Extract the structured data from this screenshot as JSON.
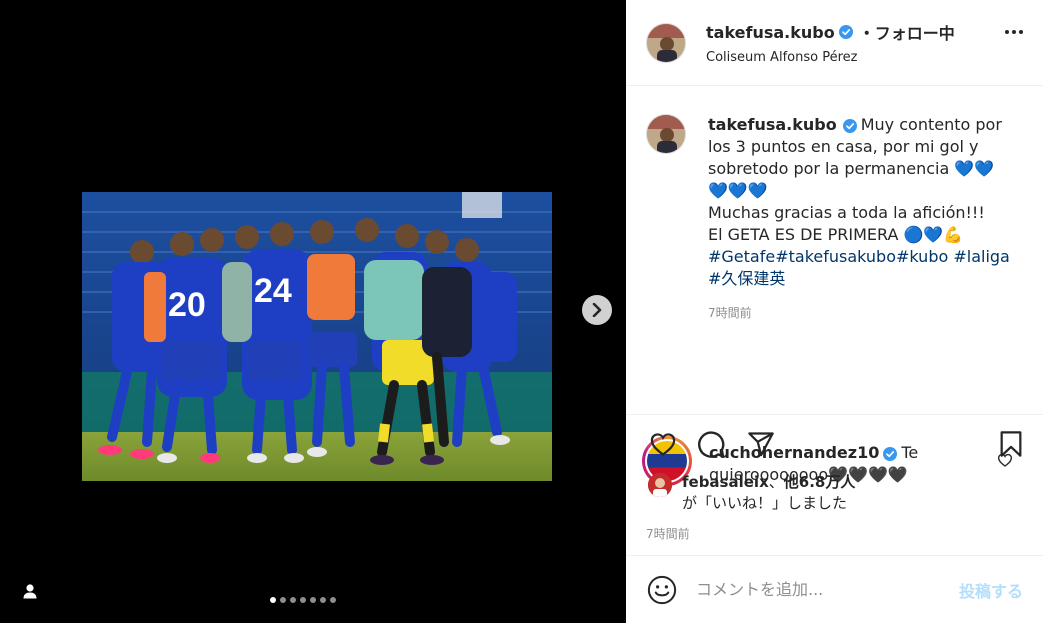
{
  "post": {
    "username": "takefusa.kubo",
    "follow_status": "・フォロー中",
    "location": "Coliseum Alfonso Pérez",
    "caption_part1": "Muy contento por los 3 puntos en casa, por mi gol y sobretodo por la permanencia",
    "caption_hearts1": " 💙💙",
    "caption_hearts2": "💙💙💙",
    "caption_line2": "Muchas gracias a toda la afición!!!",
    "caption_line3": "El GETA ES DE PRIMERA",
    "caption_line3_emoji": " 🔵💙💪",
    "hashtags": "#Getafe#takefusakubo#kubo #laliga #久保建英",
    "caption_time": "7時間前"
  },
  "comment": {
    "username": "cuchohernandez10",
    "text": "Te quieroooooooo🖤🖤🖤🖤"
  },
  "likes": {
    "first_user": "febasaleix",
    "separator": "、",
    "others": "他6.8万人",
    "suffix": "が「いいね！」しました"
  },
  "post_time": "7時間前",
  "comment_input": {
    "placeholder": "コメントを追加..."
  },
  "post_button": "投稿する",
  "media": {
    "jersey_numbers": [
      "20",
      "24"
    ],
    "slide_count": 7,
    "active_slide": 1
  },
  "colors": {
    "verified": "#3897f0",
    "hashtag": "#00376b",
    "post_button": "#b2dffc",
    "secondary_text": "#8e8e8e"
  }
}
